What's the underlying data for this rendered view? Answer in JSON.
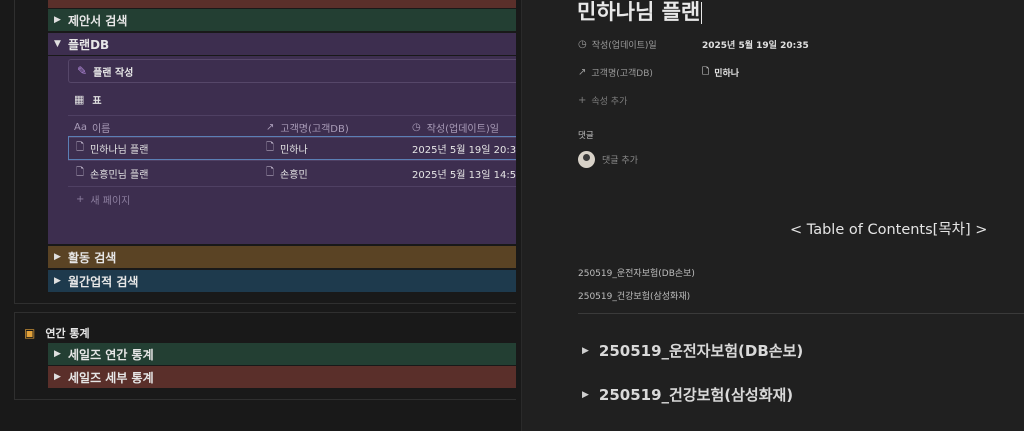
{
  "left": {
    "bars": {
      "proposal_search": "제안서 검색",
      "plan_db": "플랜DB",
      "activity_search": "활동 검색",
      "monthly_search": "월간업적 검색"
    },
    "db": {
      "new_button": "플랜 작성",
      "view_name": "표",
      "columns": {
        "name": "이름",
        "name_prefix": "Aa",
        "customer": "고객명(고객DB)",
        "updated": "작성(업데이트)일"
      },
      "rows": [
        {
          "name": "민하나님 플랜",
          "customer": "민하나",
          "updated": "2025년 5월 19일 20:3"
        },
        {
          "name": "손흥민님 플랜",
          "customer": "손흥민",
          "updated": "2025년 5월 13일 14:5"
        }
      ],
      "new_page": "새 페이지"
    },
    "annual": {
      "title": "연간 통계",
      "items": [
        "세일즈 연간 통계",
        "세일즈 세부 통계"
      ]
    },
    "colors": {
      "red": "#5a2f2a",
      "green": "#233f33",
      "purple": "#3d2e4f",
      "brown": "#5a4324",
      "blue": "#1e3a4d"
    }
  },
  "right": {
    "title": "민하나님 플랜",
    "props": {
      "updated_label": "작성(업데이트)일",
      "updated_value": "2025년 5월 19일 20:35",
      "customer_label": "고객명(고객DB)",
      "customer_value": "민하나",
      "add_prop": "속성 추가"
    },
    "comment_label": "댓글",
    "add_comment": "댓글 추가",
    "toc_title": "< Table of Contents[목차] >",
    "toc_links": [
      "250519_운전자보험(DB손보)",
      "250519_건강보험(삼성화재)"
    ],
    "toggles": [
      "250519_운전자보험(DB손보)",
      "250519_건강보험(삼성화재)"
    ]
  }
}
